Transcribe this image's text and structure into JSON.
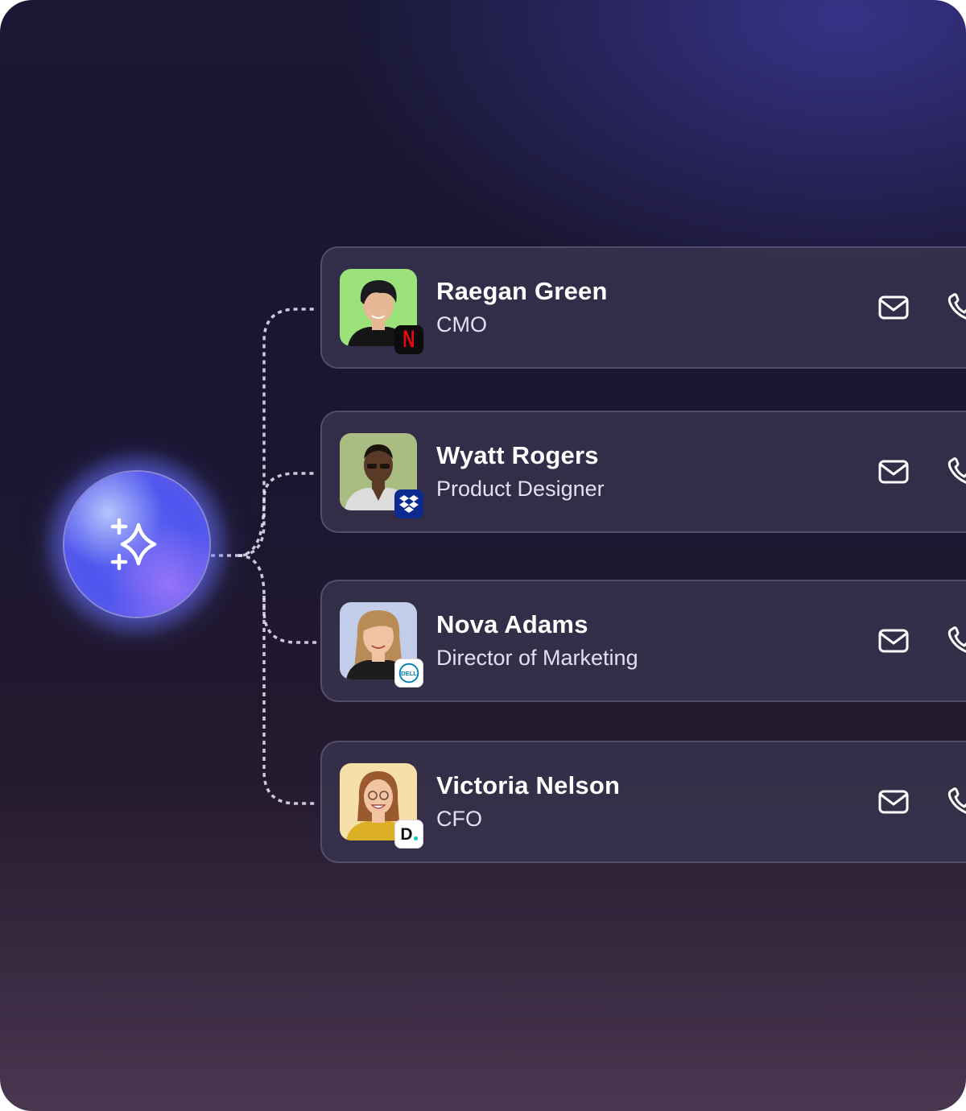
{
  "icons": {
    "assistant": "sparkles-icon",
    "email": "mail-icon",
    "call": "phone-icon"
  },
  "contacts": [
    {
      "name": "Raegan Green",
      "role": "CMO",
      "company": "Netflix",
      "badge_text": "N",
      "avatar_bg": "#9be27a",
      "skin": "#e7b896",
      "hair": "#1b1b1f",
      "shirt": "#151515"
    },
    {
      "name": "Wyatt Rogers",
      "role": "Product Designer",
      "company": "Dropbox",
      "badge_text": "",
      "avatar_bg": "#a9bd82",
      "skin": "#5a3a26",
      "hair": "#1e140e",
      "shirt": "#dcdcdc"
    },
    {
      "name": "Nova Adams",
      "role": "Director of Marketing",
      "company": "Dell",
      "badge_text": "DELL",
      "avatar_bg": "#c2cde9",
      "skin": "#f0c3a3",
      "hair": "#b98b57",
      "shirt": "#1d1d1d"
    },
    {
      "name": "Victoria Nelson",
      "role": "CFO",
      "company": "Deliveroo",
      "badge_text": "D",
      "avatar_bg": "#f6dfa8",
      "skin": "#f2c4a4",
      "hair": "#9a5a2e",
      "shirt": "#dcb025"
    }
  ],
  "colors": {
    "card_bg": "#3a3550",
    "orb": "#5058ee",
    "netflix": "#e50914",
    "dropbox": "#0061fe",
    "dell": "#007db8",
    "deliveroo_dot": "#00ccbc"
  }
}
